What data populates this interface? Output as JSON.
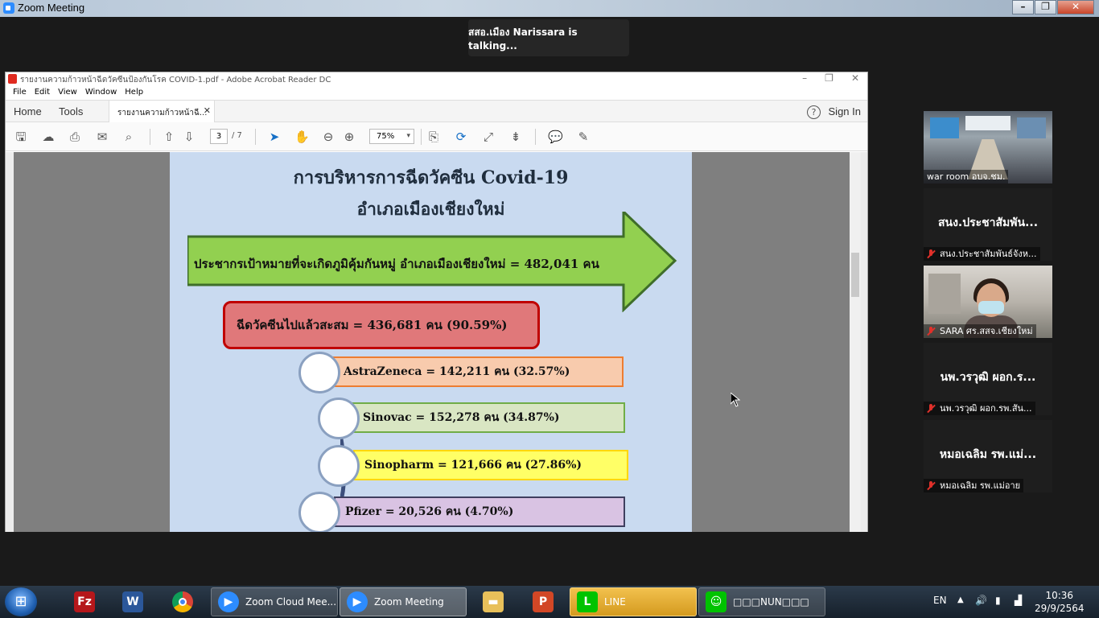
{
  "zoom": {
    "window_title": "Zoom Meeting",
    "talking": "สสอ.เมือง Narissara  is  talking...",
    "participants": [
      {
        "big_name": "",
        "label": "war room อบจ.ชม.",
        "muted": false
      },
      {
        "big_name": "สนง.ประชาสัมพัน...",
        "label": "สนง.ประชาสัมพันธ์จังห...",
        "muted": true
      },
      {
        "big_name": "",
        "label": "SARA ศร.สสจ.เชียงใหม่",
        "muted": true
      },
      {
        "big_name": "นพ.วรวุฒิ ผอก.ร...",
        "label": "นพ.วรวุฒิ ผอก.รพ.สัน...",
        "muted": true
      },
      {
        "big_name": "หมอเฉลิม รพ.แม่...",
        "label": "หมอเฉลิม รพ.แม่อาย",
        "muted": true
      }
    ]
  },
  "acrobat": {
    "title": "รายงานความก้าวหน้าฉีดวัคซีนป้องกันโรค COVID-1.pdf - Adobe Acrobat Reader DC",
    "menu": [
      "File",
      "Edit",
      "View",
      "Window",
      "Help"
    ],
    "home": "Home",
    "tools": "Tools",
    "doc_tab": "รายงานความก้าวหน้าฉี...",
    "sign_in": "Sign In",
    "page_current": "3",
    "page_total": "/ 7",
    "zoom_level": "75%"
  },
  "slide": {
    "title1": "การบริหารการฉีดวัคซีน Covid-19",
    "title2": "อำเภอเมืองเชียงใหม่",
    "target": "ประชากรเป้าหมายที่จะเกิดภูมิคุ้มกันหมู่   อำเภอเมืองเชียงใหม่  =  482,041  คน",
    "total": "ฉีดวัคซีนไปแล้วสะสม   =  436,681  คน   (90.59%)",
    "vaccines": [
      {
        "text": "AstraZeneca  =  142,211  คน  (32.57%)",
        "fill": "#f8cbad",
        "border": "#ed7d31"
      },
      {
        "text": "Sinovac  =  152,278   คน  (34.87%)",
        "fill": "#d9e6c3",
        "border": "#70ad47"
      },
      {
        "text": "Sinopharm  =  121,666  คน  (27.86%)",
        "fill": "#ffff66",
        "border": "#ffd700"
      },
      {
        "text": "Pfizer =  20,526  คน  (4.70%)",
        "fill": "#d9c3e3",
        "border": "#3f3f5f"
      }
    ]
  },
  "taskbar": {
    "apps": [
      "Zoom Cloud Mee...",
      "Zoom Meeting",
      "LINE",
      "□□□NUN□□□"
    ],
    "lang": "EN",
    "time": "10:36",
    "date": "29/9/2564"
  }
}
